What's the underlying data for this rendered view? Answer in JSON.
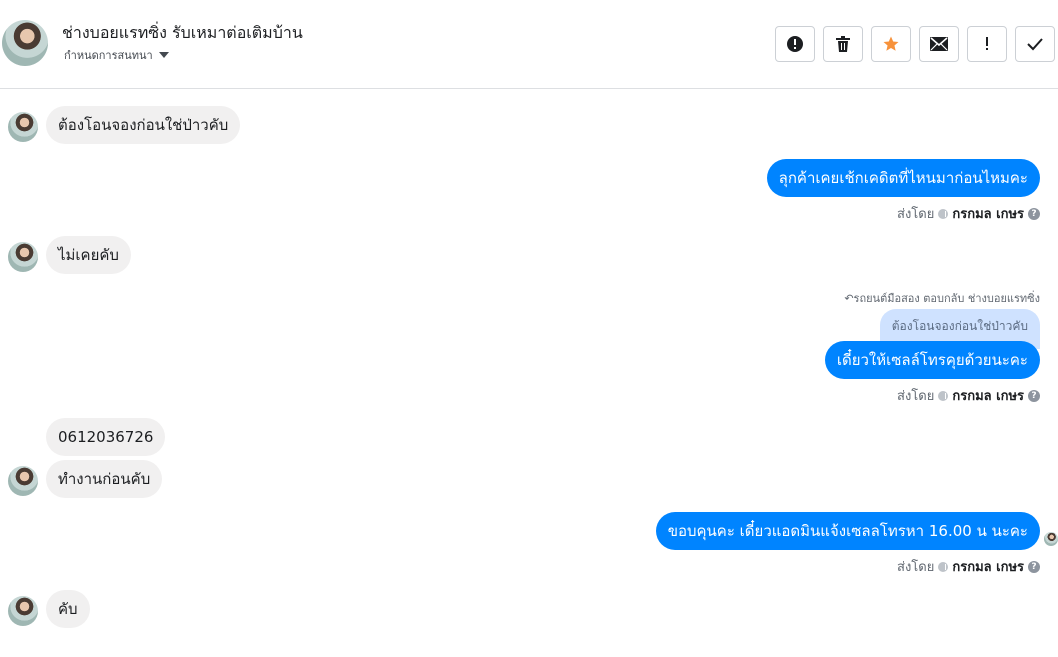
{
  "header": {
    "name": "ช่างบอยแรทซิ่ง รับเหมาต่อเติมบ้าน",
    "subtitle": "กำหนดการสนทนา",
    "buttons": [
      {
        "icon": "alert-circle-icon",
        "label": "spam"
      },
      {
        "icon": "trash-icon",
        "label": "delete"
      },
      {
        "icon": "star-icon",
        "label": "star",
        "color": "#f7923b"
      },
      {
        "icon": "envelope-icon",
        "label": "mark unread"
      },
      {
        "icon": "exclamation-icon",
        "label": "follow up"
      },
      {
        "icon": "check-icon",
        "label": "done"
      }
    ]
  },
  "messages": [
    {
      "side": "in",
      "text": "ต้องโอนจองก่อนใช่ป่าวคับ"
    },
    {
      "side": "out",
      "text": "ลุกค้าเคยเช้กเคดิตที่ไหนมาก่อนไหมคะ",
      "sent_by_label": "ส่งโดย",
      "sender": "กรกมล เกษร"
    },
    {
      "side": "in",
      "text": "ไม่เคยคับ"
    },
    {
      "side": "out",
      "reply_meta": "รถยนต์มือสอง ตอบกลับ ช่างบอยแรทซิ่ง",
      "quoted": "ต้องโอนจองก่อนใช่ป่าวคับ",
      "text": "เดี๋ยวให้เซลล์โทรคุยด้วยนะคะ",
      "sent_by_label": "ส่งโดย",
      "sender": "กรกมล เกษร"
    },
    {
      "side": "in",
      "text": "0612036726"
    },
    {
      "side": "in",
      "text": "ทำงานก่อนคับ"
    },
    {
      "side": "out",
      "text": "ขอบคุนคะ เดี๋ยวแอดมินแจ้งเซลลโทรหา 16.00 น นะคะ",
      "sent_by_label": "ส่งโดย",
      "sender": "กรกมล เกษร"
    },
    {
      "side": "in",
      "text": "คับ"
    }
  ],
  "colors": {
    "outgoing": "#0084ff",
    "incoming": "#f1f0f0",
    "star": "#f7923b"
  }
}
